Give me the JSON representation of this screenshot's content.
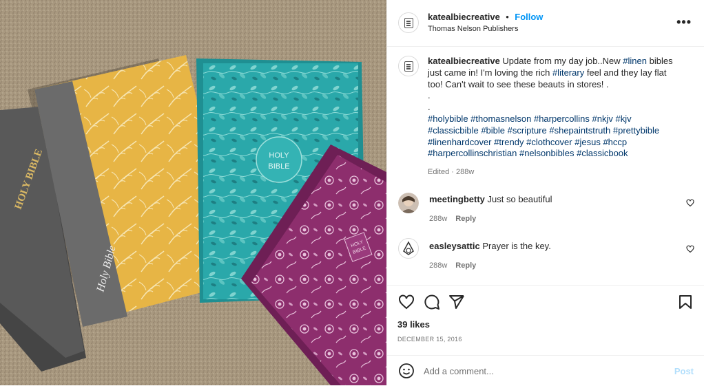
{
  "header": {
    "username": "katealbiecreative",
    "separator": "•",
    "follow_label": "Follow",
    "location": "Thomas Nelson Publishers",
    "more_label": "•••"
  },
  "caption": {
    "username": "katealbiecreative",
    "text_parts": [
      {
        "t": "Update from my day job..New ",
        "tag": false
      },
      {
        "t": "#linen",
        "tag": true
      },
      {
        "t": " bibles just came in! I'm loving the rich ",
        "tag": false
      },
      {
        "t": "#literary",
        "tag": true
      },
      {
        "t": " feel and they lay flat too! Can't wait to see these beauts in stores! .",
        "tag": false
      }
    ],
    "dots": [
      ".",
      "."
    ],
    "hashtags": [
      "#holybible",
      "#thomasnelson",
      "#harpercollins",
      "#nkjv",
      "#kjv",
      "#classicbible",
      "#bible",
      "#scripture",
      "#shepaintstruth",
      "#prettybible",
      "#linenhardcover",
      "#trendy",
      "#clothcover",
      "#jesus",
      "#hccp",
      "#harpercollinschristian",
      "#nelsonbibles",
      "#classicbook"
    ],
    "edited": "Edited · 288w"
  },
  "comments": [
    {
      "username": "meetingbetty",
      "text": "Just so beautiful",
      "age": "288w",
      "reply": "Reply"
    },
    {
      "username": "easleysattic",
      "text": "Prayer is the key.",
      "age": "288w",
      "reply": "Reply"
    }
  ],
  "icons": {
    "like": "heart-icon",
    "comment": "comment-icon",
    "share": "share-icon",
    "save": "bookmark-icon",
    "emoji": "emoji-icon"
  },
  "likes": "39 likes",
  "date": "DECEMBER 15, 2016",
  "add_comment": {
    "placeholder": "Add a comment...",
    "post_label": "Post"
  },
  "photo": {
    "book_texts": [
      "HOLY BIBLE",
      "Holy Bible",
      "HOLY",
      "BIBLE",
      "HOLY",
      "BIBLE"
    ]
  }
}
